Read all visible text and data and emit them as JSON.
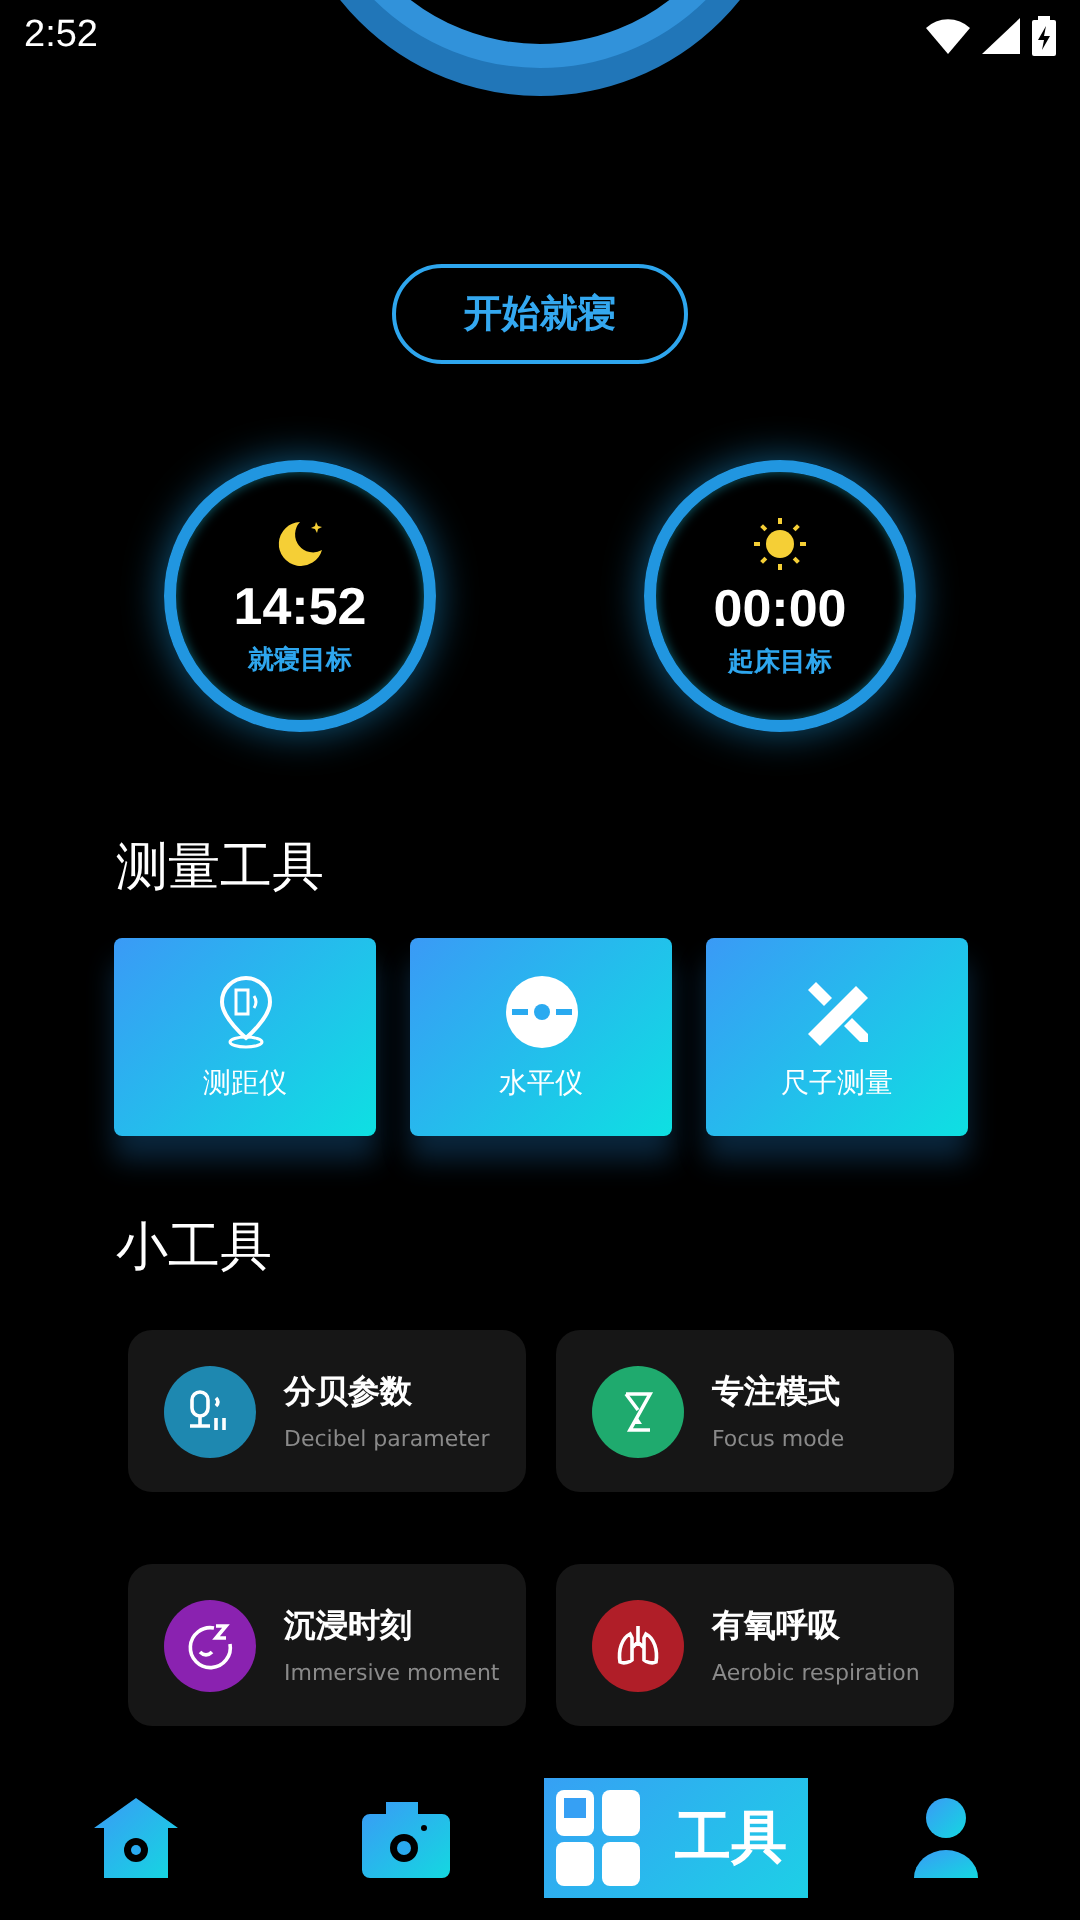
{
  "status_bar": {
    "time": "2:52"
  },
  "start_button": {
    "label": "开始就寝"
  },
  "targets": [
    {
      "kind": "moon",
      "time": "14:52",
      "label": "就寝目标"
    },
    {
      "kind": "sun",
      "time": "00:00",
      "label": "起床目标"
    }
  ],
  "measure_tools": {
    "title": "测量工具",
    "items": [
      {
        "kind": "rangefinder",
        "label": "测距仪"
      },
      {
        "kind": "level",
        "label": "水平仪"
      },
      {
        "kind": "ruler",
        "label": "尺子测量"
      }
    ]
  },
  "small_tools": {
    "title": "小工具",
    "items": [
      {
        "kind": "decibel",
        "title": "分贝参数",
        "subtitle": "Decibel parameter",
        "color": "#1e88b0"
      },
      {
        "kind": "focus",
        "title": "专注模式",
        "subtitle": "Focus mode",
        "color": "#1faa6e"
      },
      {
        "kind": "immersive",
        "title": "沉浸时刻",
        "subtitle": "Immersive moment",
        "color": "#8a22b0"
      },
      {
        "kind": "aerobic",
        "title": "有氧呼吸",
        "subtitle": "Aerobic respiration",
        "color": "#b01e28"
      }
    ]
  },
  "bottom_nav": [
    {
      "kind": "home",
      "selected": false
    },
    {
      "kind": "camera",
      "selected": false
    },
    {
      "kind": "tools",
      "label": "工具",
      "selected": true
    },
    {
      "kind": "profile",
      "selected": false
    }
  ]
}
